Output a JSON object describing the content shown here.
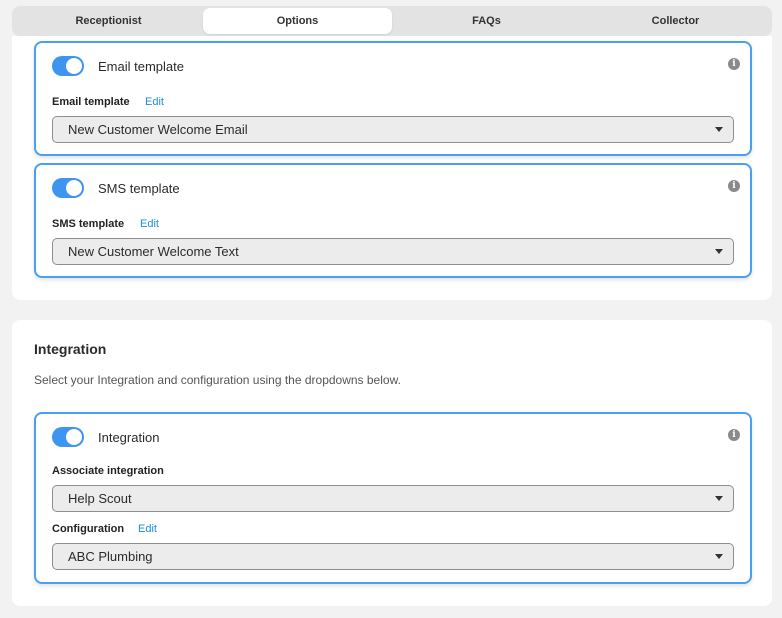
{
  "tabs": [
    {
      "label": "Receptionist",
      "active": false
    },
    {
      "label": "Options",
      "active": true
    },
    {
      "label": "FAQs",
      "active": false
    },
    {
      "label": "Collector",
      "active": false
    }
  ],
  "email_card": {
    "toggle_label": "Email template",
    "toggle_on": true,
    "field_label": "Email template",
    "edit_label": "Edit",
    "selected": "New Customer Welcome Email",
    "info_glyph": "i"
  },
  "sms_card": {
    "toggle_label": "SMS template",
    "toggle_on": true,
    "field_label": "SMS template",
    "edit_label": "Edit",
    "selected": "New Customer Welcome Text",
    "info_glyph": "i"
  },
  "integration": {
    "title": "Integration",
    "description": "Select your Integration and configuration using the dropdowns below.",
    "card": {
      "toggle_label": "Integration",
      "toggle_on": true,
      "info_glyph": "i",
      "associate_label": "Associate integration",
      "associate_selected": "Help Scout",
      "config_label": "Configuration",
      "config_edit_label": "Edit",
      "config_selected": "ABC Plumbing"
    }
  },
  "colors": {
    "accent": "#3d95f0",
    "card_border": "#4a9ff0",
    "link": "#1a8fd6",
    "background": "#f2f2f2"
  },
  "icons": {
    "info": "info-icon",
    "dropdown": "chevron-down-icon"
  }
}
